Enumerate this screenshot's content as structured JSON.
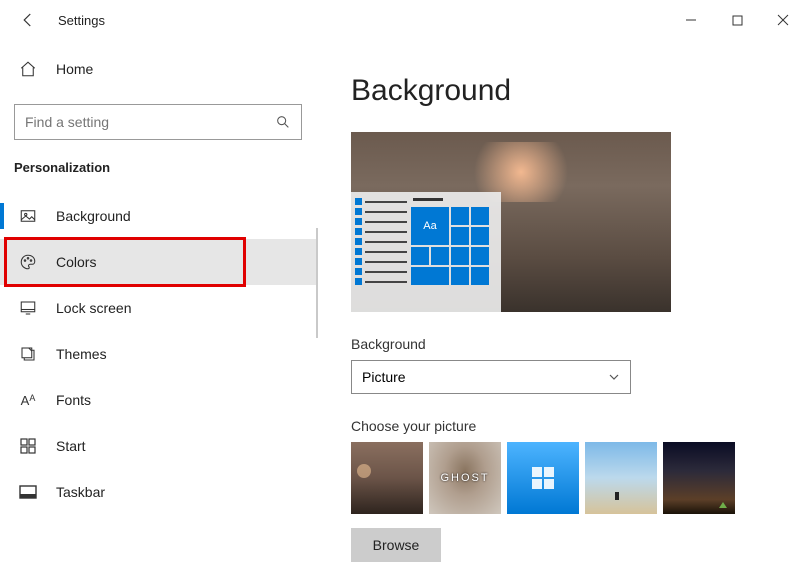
{
  "window": {
    "title": "Settings"
  },
  "sidebar": {
    "home": "Home",
    "search_placeholder": "Find a setting",
    "category": "Personalization",
    "items": [
      {
        "label": "Background"
      },
      {
        "label": "Colors"
      },
      {
        "label": "Lock screen"
      },
      {
        "label": "Themes"
      },
      {
        "label": "Fonts"
      },
      {
        "label": "Start"
      },
      {
        "label": "Taskbar"
      }
    ],
    "selected_index": 1,
    "active_bar_index": 0
  },
  "content": {
    "heading": "Background",
    "preview_sample_text": "Aa",
    "dropdown_label": "Background",
    "dropdown_value": "Picture",
    "picture_label": "Choose your picture",
    "picture_ghost_text": "GHOST",
    "browse_label": "Browse"
  }
}
